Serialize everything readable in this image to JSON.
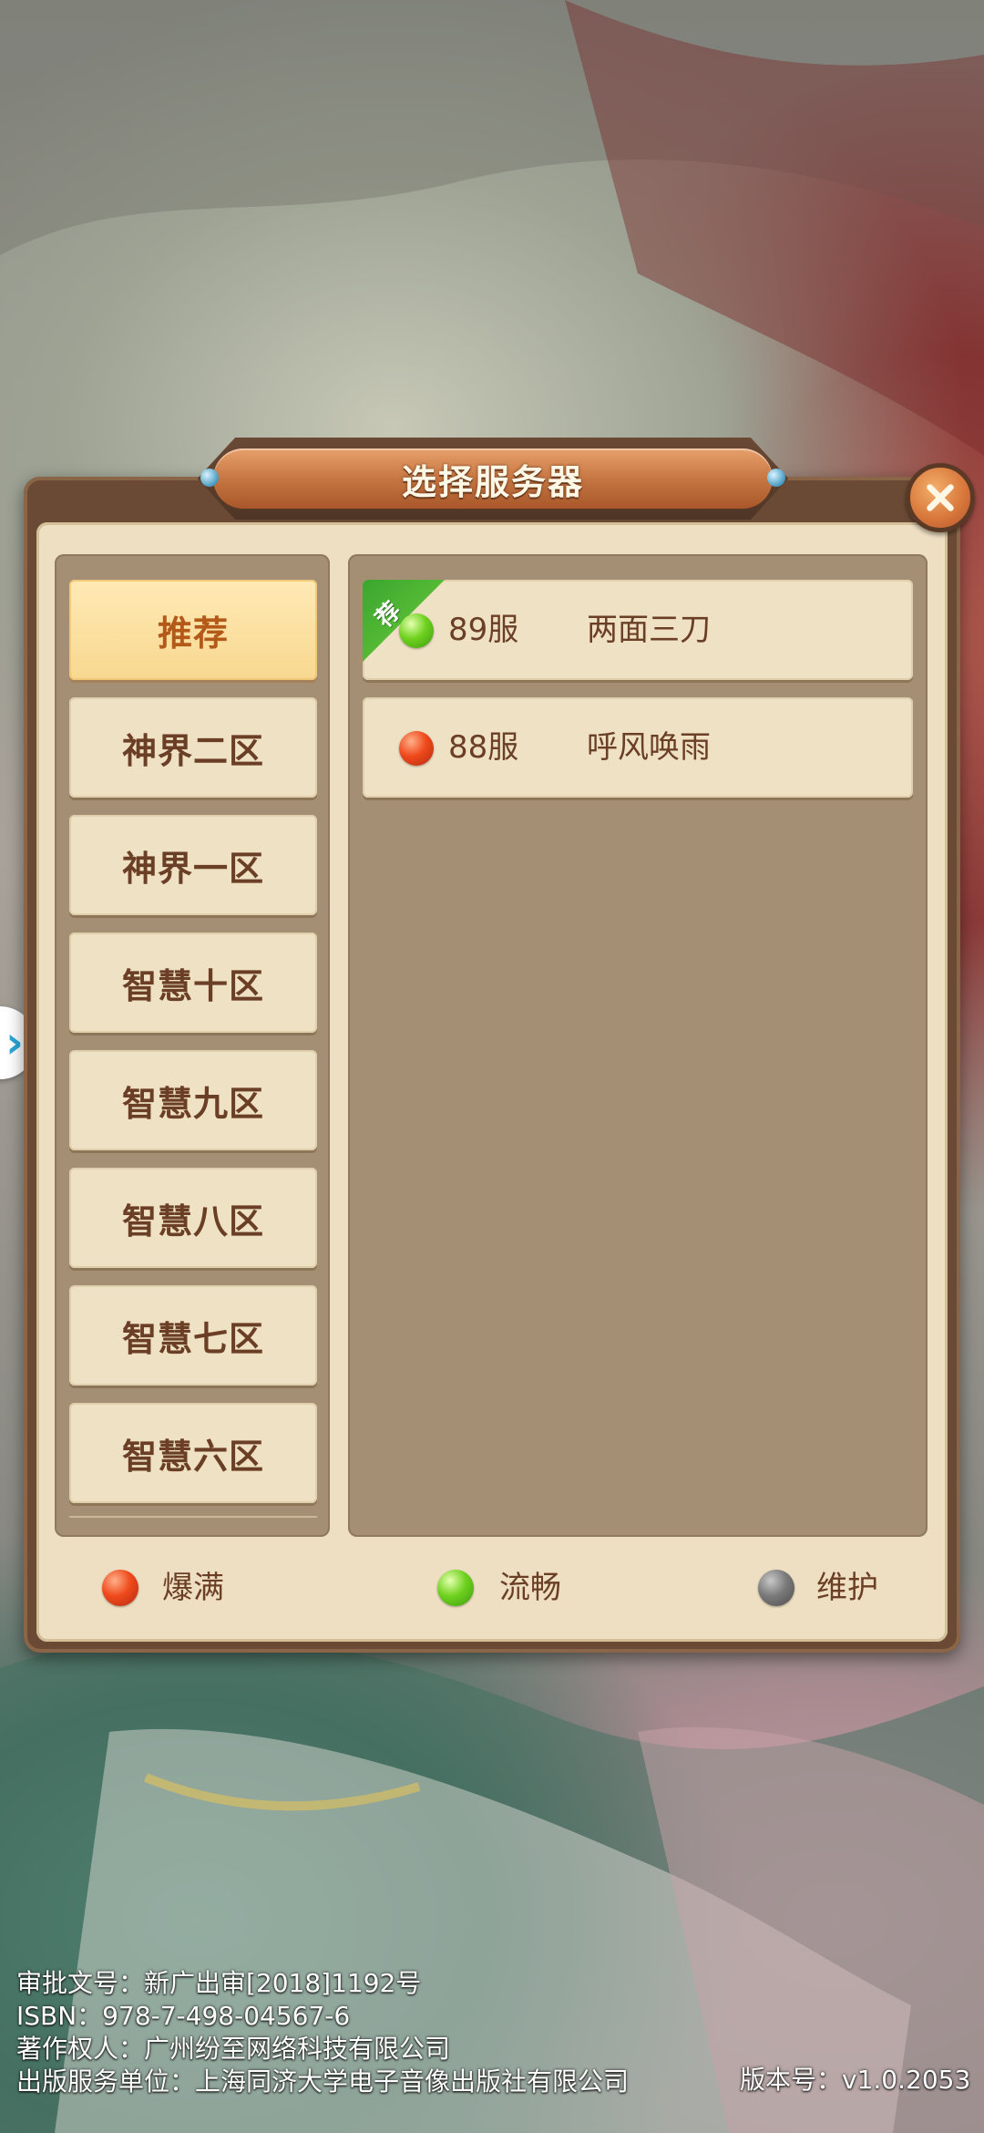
{
  "dialog": {
    "title": "选择服务器"
  },
  "zones": [
    {
      "label": "推荐",
      "active": true
    },
    {
      "label": "神界二区",
      "active": false
    },
    {
      "label": "神界一区",
      "active": false
    },
    {
      "label": "智慧十区",
      "active": false
    },
    {
      "label": "智慧九区",
      "active": false
    },
    {
      "label": "智慧八区",
      "active": false
    },
    {
      "label": "智慧七区",
      "active": false
    },
    {
      "label": "智慧六区",
      "active": false
    }
  ],
  "servers": [
    {
      "number": "89服",
      "name": "两面三刀",
      "status": "green",
      "badge": "荐"
    },
    {
      "number": "88服",
      "name": "呼风唤雨",
      "status": "red",
      "badge": ""
    }
  ],
  "legend": [
    {
      "label": "爆满",
      "color": "red"
    },
    {
      "label": "流畅",
      "color": "green"
    },
    {
      "label": "维护",
      "color": "gray"
    }
  ],
  "footer": {
    "approval": "审批文号：新广出审[2018]1192号",
    "isbn": "ISBN：978-7-498-04567-6",
    "copyright": "著作权人：广州纷至网络科技有限公司",
    "publisher": "出版服务单位：上海同济大学电子音像出版社有限公司",
    "version": "版本号：v1.0.2053"
  },
  "colors": {
    "status_full": "#ef4a1c",
    "status_smooth": "#6fd21f",
    "status_maintenance": "#7a7a7a"
  }
}
